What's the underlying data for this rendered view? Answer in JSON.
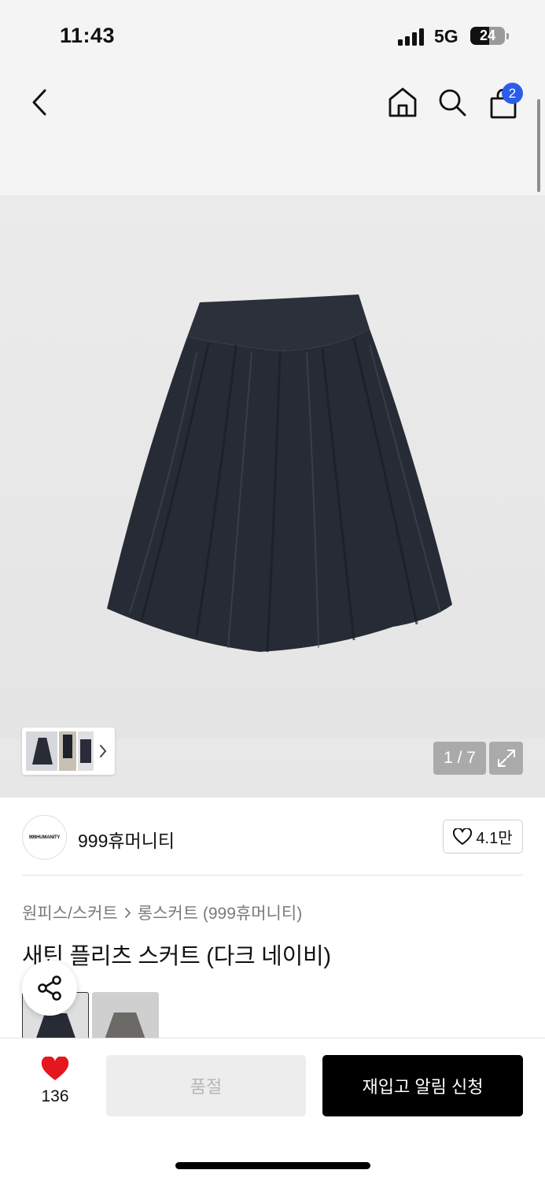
{
  "status": {
    "time": "11:43",
    "network": "5G",
    "battery": "24",
    "battery_level": 0.54
  },
  "nav": {
    "cart_count": "2"
  },
  "gallery": {
    "counter": "1 / 7"
  },
  "brand": {
    "logo_text": "999HUMANITY",
    "name": "999휴머니티",
    "likes": "4.1만"
  },
  "product": {
    "category_parent": "원피스/스커트",
    "category_child": "롱스커트 (999휴머니티)",
    "title": "새틴 플리츠 스커트 (다크 네이비)"
  },
  "bottom": {
    "wish_count": "136",
    "soldout_label": "품절",
    "restock_label": "재입고 알림 신청"
  },
  "colors": {
    "accent_blue": "#2a5de8",
    "heart_red": "#e5161d",
    "skirt_navy": "#262b35"
  }
}
